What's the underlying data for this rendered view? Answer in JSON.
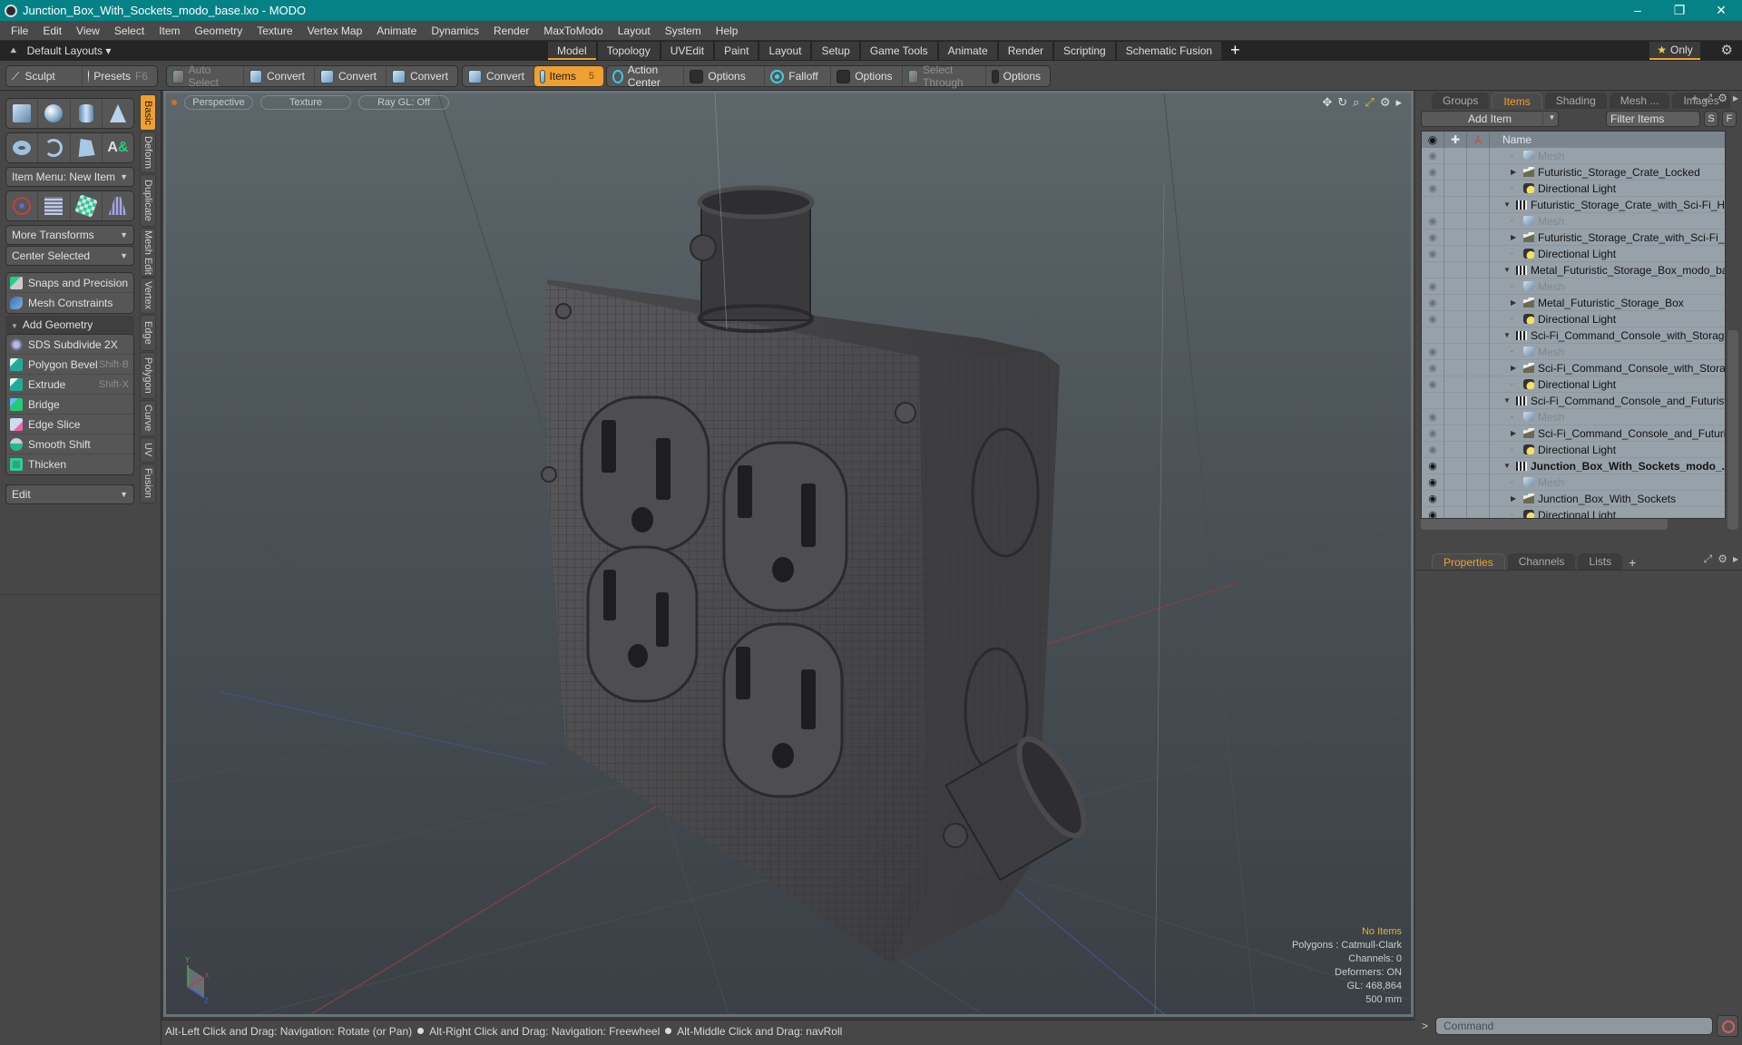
{
  "window": {
    "title": "Junction_Box_With_Sockets_modo_base.lxo - MODO",
    "controls": [
      "–",
      "❐",
      "✕"
    ]
  },
  "menu": [
    "File",
    "Edit",
    "View",
    "Select",
    "Item",
    "Geometry",
    "Texture",
    "Vertex Map",
    "Animate",
    "Dynamics",
    "Render",
    "MaxToModo",
    "Layout",
    "System",
    "Help"
  ],
  "layoutbar": {
    "layout_name": "Default Layouts ▾",
    "tabs": [
      "Model",
      "Topology",
      "UVEdit",
      "Paint",
      "Layout",
      "Setup",
      "Game Tools",
      "Animate",
      "Render",
      "Scripting",
      "Schematic Fusion"
    ],
    "active_tab": "Model",
    "add_tab": "+",
    "only_label": "Only"
  },
  "toolbar": {
    "sculpt": "Sculpt",
    "presets": "Presets",
    "presets_shortcut": "F6",
    "auto_select": "Auto Select",
    "convert1": "Convert",
    "convert2": "Convert",
    "convert3": "Convert",
    "convert4": "Convert",
    "items": "Items",
    "items_count": "5",
    "action_center": "Action Center",
    "options1": "Options",
    "falloff": "Falloff",
    "options2": "Options",
    "select_through": "Select Through",
    "options3": "Options"
  },
  "leftpanel": {
    "item_menu": "Item Menu: New Item",
    "more_transforms": "More Transforms",
    "center_selected": "Center Selected",
    "snaps": "Snaps and Precision",
    "constraints": "Mesh Constraints",
    "add_geometry": "Add Geometry",
    "tools": [
      {
        "label": "SDS Subdivide 2X",
        "shortcut": ""
      },
      {
        "label": "Polygon Bevel",
        "shortcut": "Shift-B"
      },
      {
        "label": "Extrude",
        "shortcut": "Shift-X"
      },
      {
        "label": "Bridge",
        "shortcut": ""
      },
      {
        "label": "Edge Slice",
        "shortcut": ""
      },
      {
        "label": "Smooth Shift",
        "shortcut": ""
      },
      {
        "label": "Thicken",
        "shortcut": ""
      }
    ],
    "edit": "Edit",
    "vtabs": [
      "Basic",
      "Deform",
      "Duplicate",
      "Mesh Edit",
      "Vertex",
      "Edge",
      "Polygon",
      "Curve",
      "UV",
      "Fusion"
    ],
    "active_vtab": "Basic"
  },
  "viewport": {
    "view": "Perspective",
    "shading": "Texture",
    "raygl": "Ray GL: Off",
    "info": {
      "selection": "No Items",
      "polygons": "Polygons : Catmull-Clark",
      "channels": "Channels: 0",
      "deformers": "Deformers: ON",
      "gl": "GL: 468,864",
      "scale": "500 mm"
    },
    "axis": {
      "x": "X",
      "y": "Y",
      "z": "Z"
    }
  },
  "status": {
    "hint1": "Alt-Left Click and Drag: Navigation: Rotate (or Pan)",
    "hint2": "Alt-Right Click and Drag: Navigation: Freewheel",
    "hint3": "Alt-Middle Click and Drag: navRoll"
  },
  "rightpanel": {
    "tabs": [
      "Groups",
      "Items",
      "Shading",
      "Mesh ...",
      "Images"
    ],
    "active_tab": "Items",
    "add_item": "Add Item",
    "filter": "Filter Items",
    "s_btn": "S",
    "f_btn": "F",
    "name_col": "Name",
    "items": [
      {
        "name": "Mesh",
        "type": "mesh",
        "level": 2,
        "eye": true,
        "dim": true
      },
      {
        "name": "Futuristic_Storage_Crate_Locked",
        "type": "folder",
        "level": 2,
        "eye": true,
        "expander": "▶"
      },
      {
        "name": "Directional Light",
        "type": "light",
        "level": 2,
        "eye": true
      },
      {
        "name": "Futuristic_Storage_Crate_with_Sci-Fi_Helm...",
        "type": "scene",
        "level": 1,
        "eye": false,
        "expander": "▼"
      },
      {
        "name": "Mesh",
        "type": "mesh",
        "level": 2,
        "eye": true,
        "dim": true
      },
      {
        "name": "Futuristic_Storage_Crate_with_Sci-Fi_H ...",
        "type": "folder",
        "level": 2,
        "eye": true,
        "expander": "▶"
      },
      {
        "name": "Directional Light",
        "type": "light",
        "level": 2,
        "eye": true
      },
      {
        "name": "Metal_Futuristic_Storage_Box_modo_base ...",
        "type": "scene",
        "level": 1,
        "eye": false,
        "expander": "▼"
      },
      {
        "name": "Mesh",
        "type": "mesh",
        "level": 2,
        "eye": true,
        "dim": true
      },
      {
        "name": "Metal_Futuristic_Storage_Box",
        "type": "folder",
        "level": 2,
        "eye": true,
        "expander": "▶"
      },
      {
        "name": "Directional Light",
        "type": "light",
        "level": 2,
        "eye": true
      },
      {
        "name": "Sci-Fi_Command_Console_with_Storage_C ...",
        "type": "scene",
        "level": 1,
        "eye": false,
        "expander": "▼"
      },
      {
        "name": "Mesh",
        "type": "mesh",
        "level": 2,
        "eye": true,
        "dim": true
      },
      {
        "name": "Sci-Fi_Command_Console_with_Storage ...",
        "type": "folder",
        "level": 2,
        "eye": true,
        "expander": "▶"
      },
      {
        "name": "Directional Light",
        "type": "light",
        "level": 2,
        "eye": true
      },
      {
        "name": "Sci-Fi_Command_Console_and_Futuristic_ ...",
        "type": "scene",
        "level": 1,
        "eye": false,
        "expander": "▼"
      },
      {
        "name": "Mesh",
        "type": "mesh",
        "level": 2,
        "eye": true,
        "dim": true
      },
      {
        "name": "Sci-Fi_Command_Console_and_Futuristi ...",
        "type": "folder",
        "level": 2,
        "eye": true,
        "expander": "▶"
      },
      {
        "name": "Directional Light",
        "type": "light",
        "level": 2,
        "eye": true
      },
      {
        "name": "Junction_Box_With_Sockets_modo_...",
        "type": "scene",
        "level": 1,
        "eye": true,
        "bold": true,
        "expander": "▼"
      },
      {
        "name": "Mesh",
        "type": "mesh",
        "level": 2,
        "eye": true,
        "dim": true,
        "boldeye": true
      },
      {
        "name": "Junction_Box_With_Sockets",
        "type": "folder",
        "level": 2,
        "eye": true,
        "expander": "▶",
        "boldeye": true
      },
      {
        "name": "Directional Light",
        "type": "light",
        "level": 2,
        "eye": true,
        "boldeye": true
      }
    ],
    "lower_tabs": [
      "Properties",
      "Channels",
      "Lists"
    ],
    "lower_active": "Properties",
    "command_placeholder": "Command"
  }
}
